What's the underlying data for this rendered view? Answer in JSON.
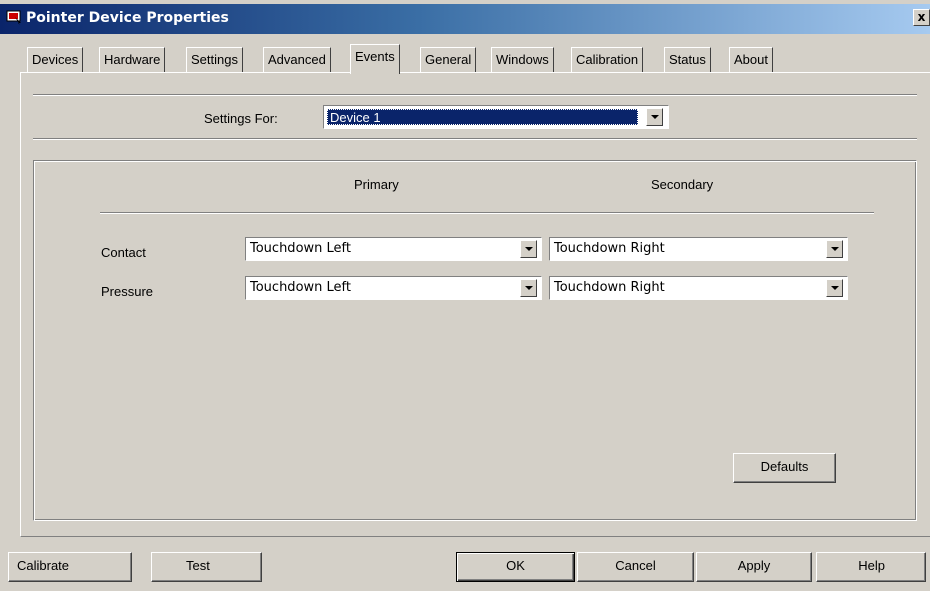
{
  "window": {
    "title": "Pointer Device Properties",
    "close_label": "x",
    "app_icon": "pointer-device-icon"
  },
  "tabs": [
    {
      "label": "Devices",
      "active": false
    },
    {
      "label": "Hardware",
      "active": false
    },
    {
      "label": "Settings",
      "active": false
    },
    {
      "label": "Advanced",
      "active": false
    },
    {
      "label": "Events",
      "active": true
    },
    {
      "label": "General",
      "active": false
    },
    {
      "label": "Windows",
      "active": false
    },
    {
      "label": "Calibration",
      "active": false
    },
    {
      "label": "Status",
      "active": false
    },
    {
      "label": "About",
      "active": false
    }
  ],
  "settings_for": {
    "label": "Settings For:",
    "value": "Device 1"
  },
  "events": {
    "primary_header": "Primary",
    "secondary_header": "Secondary",
    "rows": [
      {
        "label": "Contact",
        "primary": "Touchdown Left",
        "secondary": "Touchdown Right"
      },
      {
        "label": "Pressure",
        "primary": "Touchdown Left",
        "secondary": "Touchdown Right"
      }
    ],
    "defaults_label": "Defaults"
  },
  "buttons": {
    "calibrate": "Calibrate",
    "test": "Test",
    "ok": "OK",
    "cancel": "Cancel",
    "apply": "Apply",
    "help": "Help"
  }
}
